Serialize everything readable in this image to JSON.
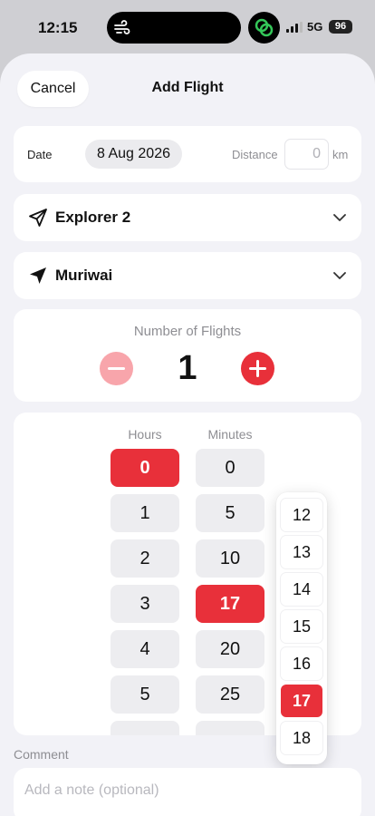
{
  "status_bar": {
    "time": "12:15",
    "network": "5G",
    "battery": "96",
    "icons": [
      "wind-icon",
      "link-badge-icon",
      "signal-icon"
    ]
  },
  "header": {
    "cancel_label": "Cancel",
    "title": "Add Flight"
  },
  "date_row": {
    "date_label": "Date",
    "date_value": "8 Aug 2026",
    "distance_label": "Distance",
    "distance_value": "0",
    "distance_unit": "km"
  },
  "aircraft": {
    "label": "Explorer 2",
    "icon": "paper-plane-icon"
  },
  "location": {
    "label": "Muriwai",
    "icon": "location-arrow-icon"
  },
  "flights": {
    "label": "Number of Flights",
    "value": "1"
  },
  "duration": {
    "hours_label": "Hours",
    "minutes_label": "Minutes",
    "hours": [
      "0",
      "1",
      "2",
      "3",
      "4",
      "5"
    ],
    "selected_hour": "0",
    "minutes": [
      "0",
      "5",
      "10",
      "17",
      "20",
      "25"
    ],
    "selected_minute": "17",
    "minute_picker_options": [
      "12",
      "13",
      "14",
      "15",
      "16",
      "17",
      "18"
    ]
  },
  "comment": {
    "label": "Comment",
    "placeholder": "Add a note (optional)"
  },
  "colors": {
    "accent": "#e8303a",
    "accent_light": "#f8a5ab",
    "background": "#f2f2f7"
  }
}
